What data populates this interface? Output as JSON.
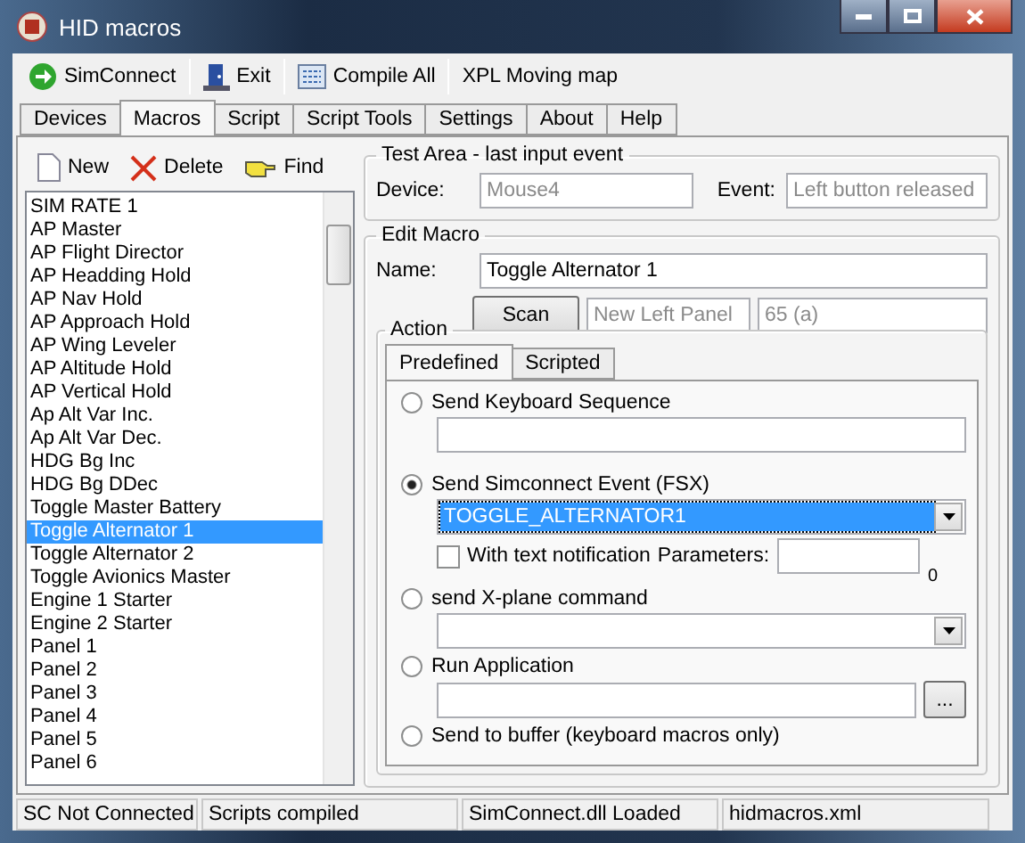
{
  "window": {
    "title": "HID macros"
  },
  "toolbar": [
    {
      "label": "SimConnect",
      "kind": "connect"
    },
    {
      "label": "Exit",
      "kind": "exit"
    },
    {
      "label": "Compile All",
      "kind": "compile"
    },
    {
      "label": "XPL Moving map",
      "kind": "plain"
    }
  ],
  "tabs": [
    {
      "label": "Devices",
      "selected": false
    },
    {
      "label": "Macros",
      "selected": true
    },
    {
      "label": "Script",
      "selected": false
    },
    {
      "label": "Script Tools",
      "selected": false
    },
    {
      "label": "Settings",
      "selected": false
    },
    {
      "label": "About",
      "selected": false
    },
    {
      "label": "Help",
      "selected": false
    }
  ],
  "macro_toolbar": [
    {
      "label": "New",
      "kind": "new"
    },
    {
      "label": "Delete",
      "kind": "delete"
    },
    {
      "label": "Find",
      "kind": "find"
    }
  ],
  "macros": [
    {
      "label": "SIM RATE 1",
      "selected": false
    },
    {
      "label": "AP Master",
      "selected": false
    },
    {
      "label": "AP Flight Director",
      "selected": false
    },
    {
      "label": "AP Headding Hold",
      "selected": false
    },
    {
      "label": "AP Nav Hold",
      "selected": false
    },
    {
      "label": "AP Approach Hold",
      "selected": false
    },
    {
      "label": "AP Wing Leveler",
      "selected": false
    },
    {
      "label": "AP Altitude Hold",
      "selected": false
    },
    {
      "label": "AP Vertical Hold",
      "selected": false
    },
    {
      "label": "Ap Alt Var Inc.",
      "selected": false
    },
    {
      "label": "Ap Alt Var Dec.",
      "selected": false
    },
    {
      "label": "HDG Bg Inc",
      "selected": false
    },
    {
      "label": "HDG Bg DDec",
      "selected": false
    },
    {
      "label": "Toggle Master Battery",
      "selected": false
    },
    {
      "label": "Toggle Alternator 1",
      "selected": true
    },
    {
      "label": "Toggle Alternator 2",
      "selected": false
    },
    {
      "label": "Toggle Avionics Master",
      "selected": false
    },
    {
      "label": "Engine 1 Starter",
      "selected": false
    },
    {
      "label": "Engine 2 Starter",
      "selected": false
    },
    {
      "label": "Panel 1",
      "selected": false
    },
    {
      "label": "Panel 2",
      "selected": false
    },
    {
      "label": "Panel 3",
      "selected": false
    },
    {
      "label": "Panel 4",
      "selected": false
    },
    {
      "label": "Panel 5",
      "selected": false
    },
    {
      "label": "Panel 6",
      "selected": false
    }
  ],
  "test_area": {
    "title": "Test Area - last input event",
    "device_label": "Device:",
    "device": "Mouse4",
    "event_label": "Event:",
    "event": "Left button released"
  },
  "edit_macro": {
    "title": "Edit Macro",
    "name_label": "Name:",
    "name": "Toggle Alternator 1",
    "scan_button": "Scan",
    "trigger_device": "New Left Panel",
    "trigger_key": "65  (a)"
  },
  "action": {
    "title": "Action",
    "tabs": [
      {
        "label": "Predefined",
        "selected": true
      },
      {
        "label": "Scripted",
        "selected": false
      }
    ],
    "options": [
      {
        "label": "Send Keyboard Sequence",
        "selected": false,
        "kind": "text"
      },
      {
        "label": "Send Simconnect Event (FSX)",
        "selected": true,
        "kind": "combo",
        "value": "TOGGLE_ALTERNATOR1",
        "notification": {
          "label": "With text notification",
          "checked": false
        },
        "parameters_label": "Parameters:",
        "count": "0"
      },
      {
        "label": "send X-plane command",
        "selected": false,
        "kind": "combo"
      },
      {
        "label": "Run Application",
        "selected": false,
        "kind": "browse",
        "browse_button": "..."
      },
      {
        "label": "Send to buffer (keyboard macros only)",
        "selected": false,
        "kind": "none"
      }
    ]
  },
  "status_bar": [
    "SC Not Connected",
    "Scripts compiled",
    "SimConnect.dll Loaded",
    "hidmacros.xml"
  ]
}
